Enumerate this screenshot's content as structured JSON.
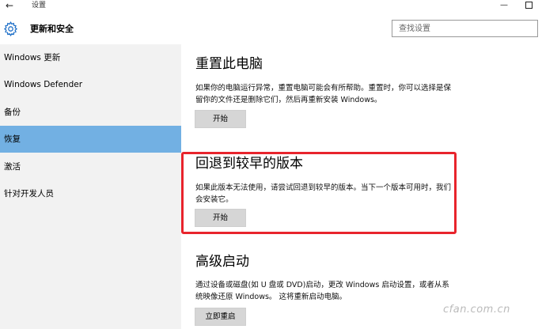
{
  "window": {
    "title": "设置",
    "back_glyph": "←",
    "minimize_glyph": "—"
  },
  "header": {
    "title": "更新和安全",
    "search_placeholder": "查找设置"
  },
  "sidebar": {
    "items": [
      {
        "label": "Windows 更新"
      },
      {
        "label": "Windows Defender"
      },
      {
        "label": "备份"
      },
      {
        "label": "恢复",
        "active": true
      },
      {
        "label": "激活"
      },
      {
        "label": "针对开发人员"
      }
    ]
  },
  "main": {
    "sections": [
      {
        "title": "重置此电脑",
        "desc": "如果你的电脑运行异常，重置电脑可能会有所帮助。重置时，你可以选择是保留你的文件还是删除它们，然后再重新安装 Windows。",
        "button": "开始"
      },
      {
        "title": "回退到较早的版本",
        "desc": "如果此版本无法使用，请尝试回退到较早的版本。当下一个版本可用时，我们会安装它。",
        "button": "开始"
      },
      {
        "title": "高级启动",
        "desc": "通过设备或磁盘(如 U 盘或 DVD)启动，更改 Windows 启动设置，或者从系统映像还原 Windows。 这将重新启动电脑。",
        "button": "立即重启"
      }
    ]
  },
  "watermark": "cfan.com.cn",
  "colors": {
    "accent": "#1e6fc8",
    "sidebar_active": "#72b0e3",
    "highlight_border": "#e8242c"
  }
}
